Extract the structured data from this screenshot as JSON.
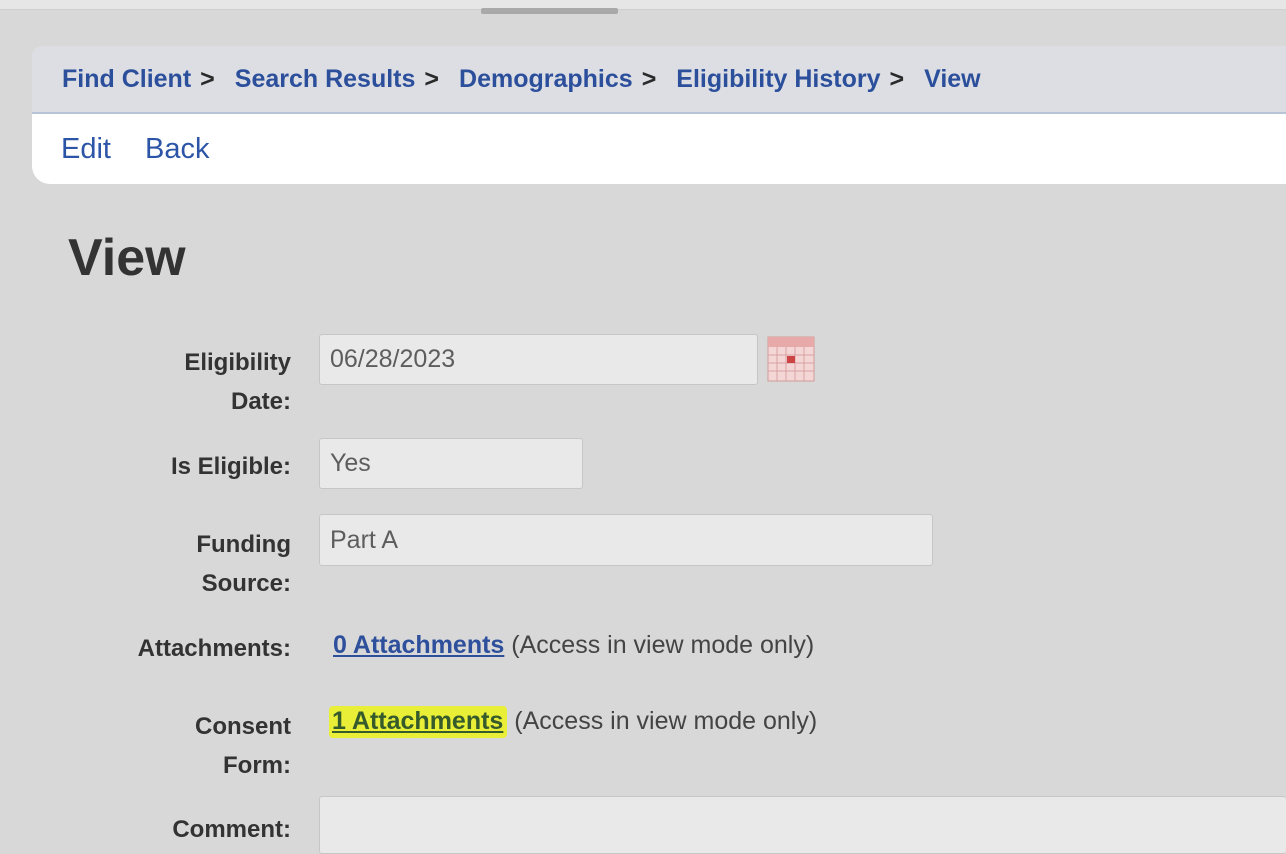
{
  "breadcrumb": {
    "items": [
      "Find Client",
      "Search Results",
      "Demographics",
      "Eligibility History",
      "View"
    ],
    "separator": ">"
  },
  "actions": {
    "edit": "Edit",
    "back": "Back"
  },
  "page_title": "View",
  "form": {
    "eligibility_date_label_1": "Eligibility",
    "eligibility_date_label_2": "Date:",
    "eligibility_date_value": "06/28/2023",
    "is_eligible_label": "Is Eligible:",
    "is_eligible_value": "Yes",
    "funding_source_label_1": "Funding",
    "funding_source_label_2": "Source:",
    "funding_source_value": "Part A",
    "attachments_label": "Attachments:",
    "attachments_link": "0 Attachments",
    "attachments_note": "(Access in view mode only)",
    "consent_label_1": "Consent",
    "consent_label_2": "Form:",
    "consent_link": "1 Attachments",
    "consent_note": "(Access in view mode only)",
    "comment_label": "Comment:",
    "comment_value": ""
  },
  "icons": {
    "calendar": "calendar-icon"
  },
  "colors": {
    "link": "#2c4f9c",
    "highlight": "#e9ee37",
    "background": "#d8d8d8"
  }
}
